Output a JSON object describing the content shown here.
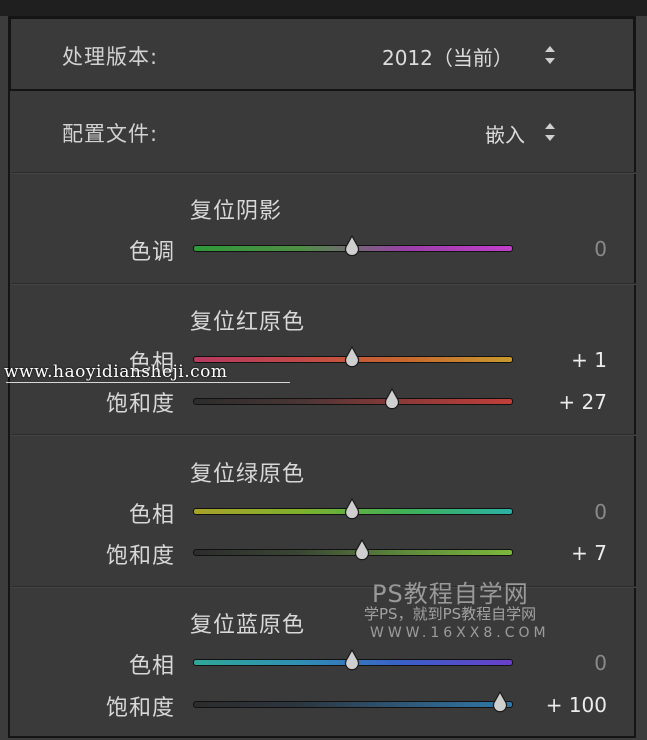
{
  "process": {
    "label": "处理版本:",
    "value": "2012（当前）"
  },
  "profile": {
    "label": "配置文件:",
    "value": "嵌入"
  },
  "sections": [
    {
      "title": "复位阴影",
      "sliders": [
        {
          "label": "色调",
          "value": "0",
          "position": 0.5,
          "colors": [
            "#2f9a3a",
            "#4f8f45",
            "#9a3fa8",
            "#c23fcb"
          ]
        }
      ]
    },
    {
      "title": "复位红原色",
      "sliders": [
        {
          "label": "色相",
          "value": "+ 1",
          "position": 0.5,
          "colors": [
            "#b63a60",
            "#c24848",
            "#c8682e",
            "#c89a2e"
          ]
        },
        {
          "label": "饱和度",
          "value": "+ 27",
          "position": 0.626,
          "colors": [
            "#2c2c2c",
            "#4a3535",
            "#8e3a38",
            "#c23e3a"
          ]
        }
      ]
    },
    {
      "title": "复位绿原色",
      "sliders": [
        {
          "label": "色相",
          "value": "0",
          "position": 0.5,
          "colors": [
            "#a8a22a",
            "#7fb02c",
            "#3fb058",
            "#2ab0a4"
          ]
        },
        {
          "label": "饱和度",
          "value": "+ 7",
          "position": 0.532,
          "colors": [
            "#2c2c2c",
            "#3a4634",
            "#5f8a3c",
            "#7cb83c"
          ]
        }
      ]
    },
    {
      "title": "复位蓝原色",
      "sliders": [
        {
          "label": "色相",
          "value": "0",
          "position": 0.5,
          "colors": [
            "#2fa898",
            "#2f8fb4",
            "#3a5ec8",
            "#6a3fc8"
          ]
        },
        {
          "label": "饱和度",
          "value": "+ 100",
          "position": 0.965,
          "colors": [
            "#2c2c2c",
            "#2c3640",
            "#2f5878",
            "#2f78a8"
          ]
        }
      ]
    }
  ],
  "watermarks": {
    "url": "www.haoyidiansheji.com",
    "ps_title": "PS教程自学网",
    "ps_sub": "学PS，就到PS教程自学网",
    "ps_domain": "WWW.16XX8.COM"
  }
}
